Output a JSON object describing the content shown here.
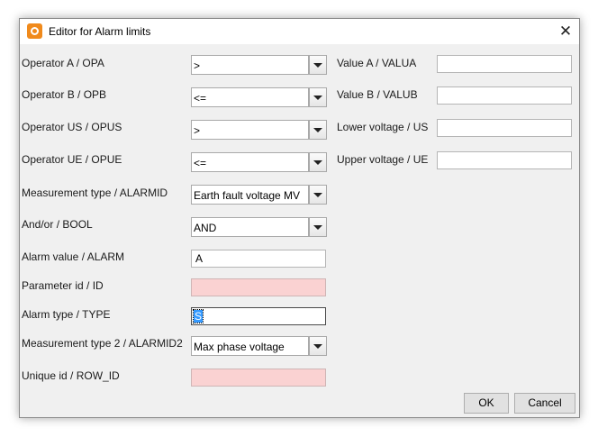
{
  "window": {
    "title": "Editor for Alarm limits",
    "close_glyph": "✕"
  },
  "labels": {
    "opa": "Operator A / OPA",
    "opb": "Operator B / OPB",
    "opus": "Operator US / OPUS",
    "opue": "Operator UE / OPUE",
    "alarmid": "Measurement type / ALARMID",
    "bool": "And/or / BOOL",
    "alarm": "Alarm value / ALARM",
    "id": "Parameter id / ID",
    "type": "Alarm type / TYPE",
    "alarmid2": "Measurement type 2 / ALARMID2",
    "row_id": "Unique id / ROW_ID",
    "valua": "Value A / VALUA",
    "valub": "Value B / VALUB",
    "us": "Lower voltage / US",
    "ue": "Upper voltage / UE"
  },
  "values": {
    "opa": ">",
    "opb": "<=",
    "opus": ">",
    "opue": "<=",
    "alarmid": "Earth fault voltage MV",
    "bool": "AND",
    "alarm": "A",
    "id": "",
    "type": "S",
    "alarmid2": "Max phase voltage",
    "row_id": "",
    "valua": "",
    "valub": "",
    "us": "",
    "ue": ""
  },
  "buttons": {
    "ok": "OK",
    "cancel": "Cancel"
  },
  "icons": {
    "app": "app-logo-icon",
    "close": "close-icon",
    "dropdown": "chevron-down-icon"
  },
  "colors": {
    "accent": "#f08a1c",
    "disabled_field": "#fad2d2",
    "selection": "#3399ff"
  }
}
